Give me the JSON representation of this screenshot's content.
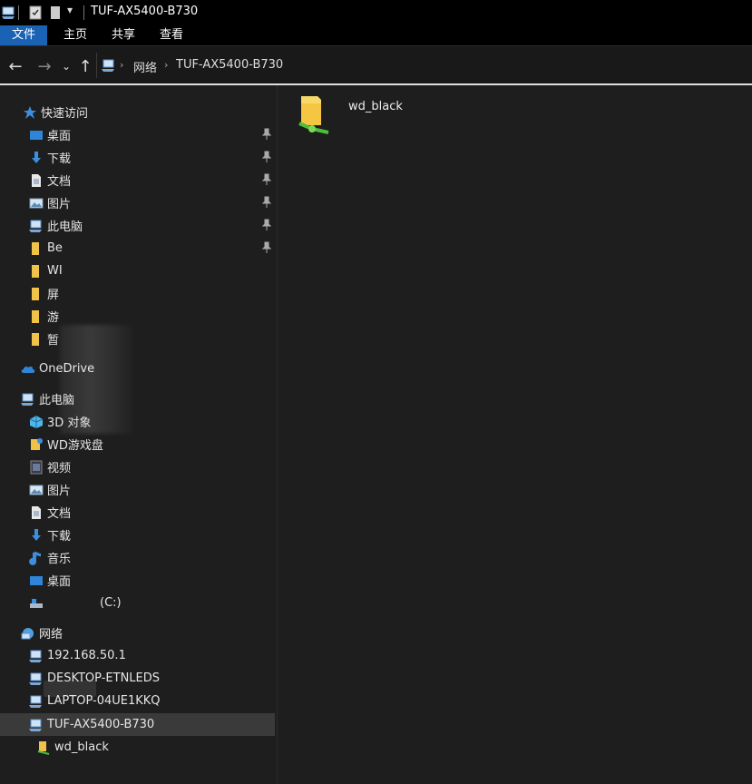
{
  "window": {
    "title": "TUF-AX5400-B730"
  },
  "ribbon": {
    "tabs": [
      "文件",
      "主页",
      "共享",
      "查看"
    ]
  },
  "address": {
    "crumbs": [
      "网络",
      "TUF-AX5400-B730"
    ]
  },
  "nav": {
    "quick_access": {
      "label": "快速访问",
      "items": [
        "桌面",
        "下载",
        "文档",
        "图片",
        "此电脑",
        "Be",
        "WI",
        "屏",
        "游",
        "暂"
      ]
    },
    "onedrive": {
      "label": "OneDrive"
    },
    "this_pc": {
      "label": "此电脑",
      "items": [
        "3D 对象",
        "WD游戏盘",
        "视频",
        "图片",
        "文档",
        "下载",
        "音乐",
        "桌面"
      ],
      "drive_label": "(C:)"
    },
    "network": {
      "label": "网络",
      "items": [
        "192.168.50.1",
        "DESKTOP-ETNLEDS",
        "LAPTOP-04UE1KKQ",
        "TUF-AX5400-B730"
      ],
      "child": "wd_black"
    }
  },
  "content": {
    "items": [
      {
        "name": "wd_black"
      }
    ]
  },
  "colors": {
    "file_tab": "#1a63b4",
    "selected": "#3a3a3a"
  }
}
